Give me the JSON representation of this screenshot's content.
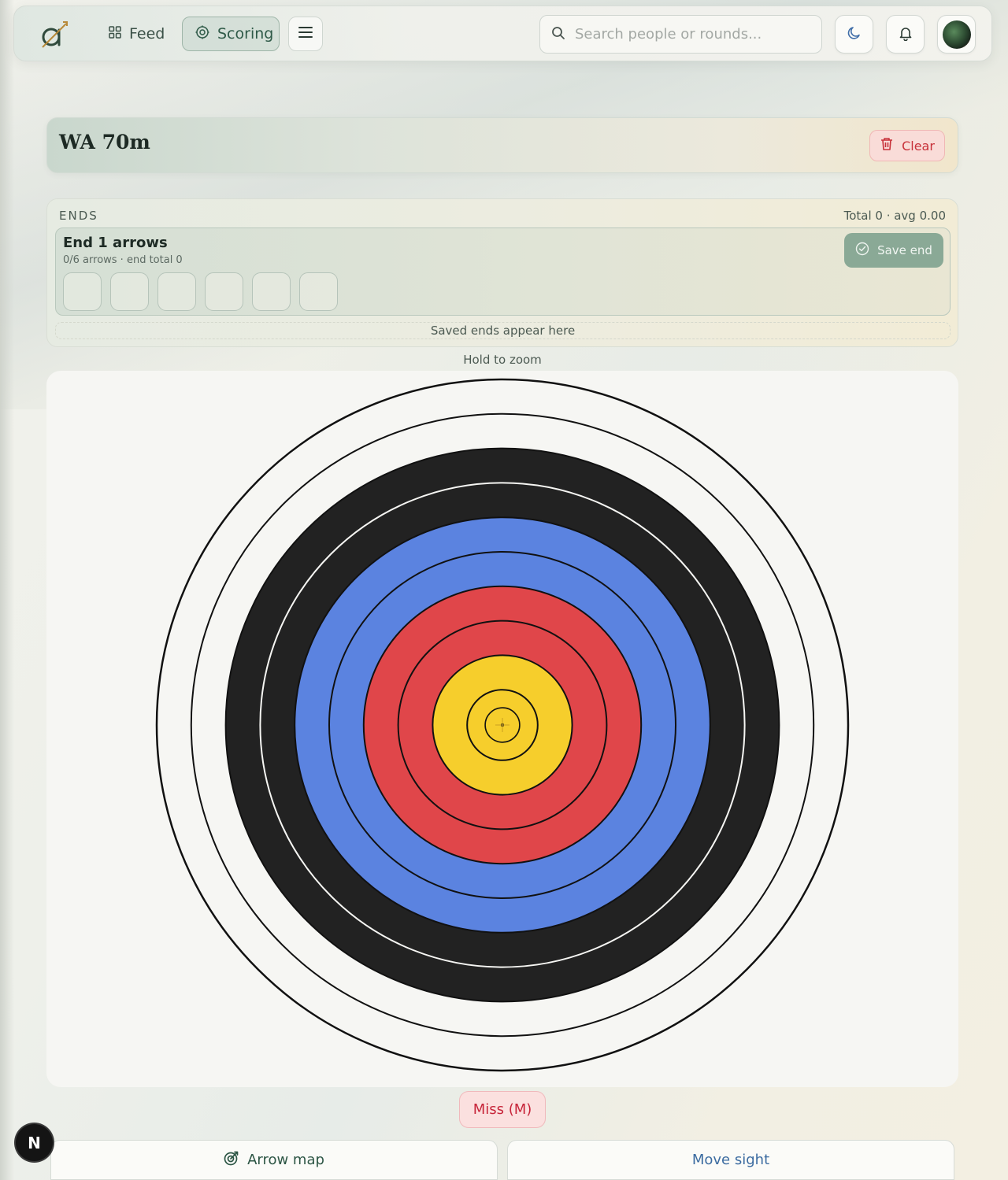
{
  "nav": {
    "feed_label": "Feed",
    "scoring_label": "Scoring",
    "search_placeholder": "Search people or rounds..."
  },
  "round": {
    "title": "WA 70m",
    "clear_label": "Clear"
  },
  "ends": {
    "section_label": "ENDS",
    "total_text": "Total 0 · avg 0.00",
    "current_end_title": "End 1 arrows",
    "current_end_sub": "0/6 arrows · end total 0",
    "arrow_slots": 6,
    "save_label": "Save end",
    "saved_hint": "Saved ends appear here"
  },
  "target": {
    "zoom_hint": "Hold to zoom",
    "ring_colors": [
      "#f6f6f3",
      "#f6f6f3",
      "#222222",
      "#222222",
      "#5b83e0",
      "#5b83e0",
      "#e0464a",
      "#e0464a",
      "#f6ce2c",
      "#f6ce2c",
      "#f6ce2c"
    ],
    "miss_label": "Miss (M)"
  },
  "footer": {
    "arrow_map_label": "Arrow map",
    "move_sight_label": "Move sight",
    "badge_letter": "N"
  },
  "colors": {
    "accent": "#2f5a48",
    "danger": "#c8323a",
    "link_blue": "#3b6ba0"
  }
}
